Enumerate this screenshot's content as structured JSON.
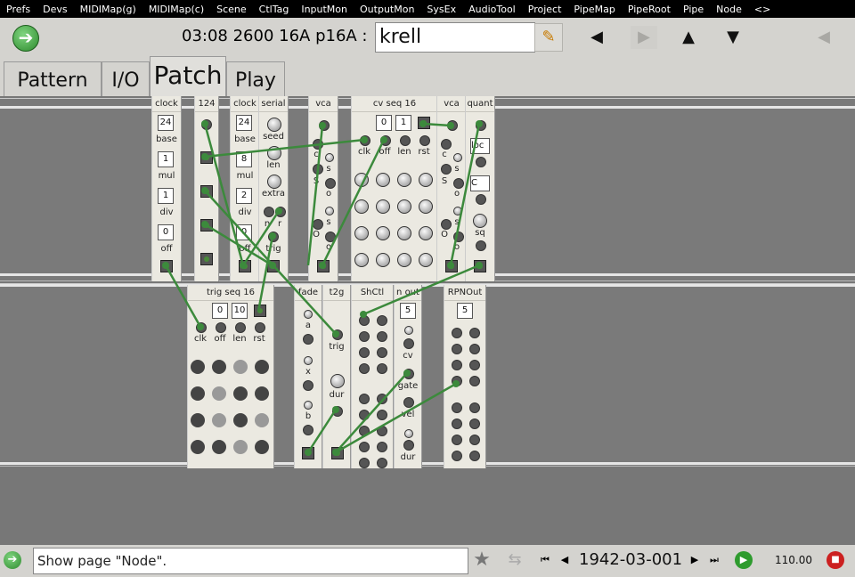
{
  "menu": [
    "Prefs",
    "Devs",
    "MIDIMap(g)",
    "MIDIMap(c)",
    "Scene",
    "CtlTag",
    "InputMon",
    "OutputMon",
    "SysEx",
    "AudioTool",
    "Project",
    "PipeMap",
    "PipeRoot",
    "Pipe",
    "Node",
    "<>"
  ],
  "toolbar": {
    "status": "03:08 2600  16A  p16A :",
    "name_value": "krell"
  },
  "tabs": [
    "Pattern",
    "I/O",
    "Patch",
    "Play"
  ],
  "modules_top": [
    {
      "title": "clock",
      "labels": [
        "base",
        "mul",
        "div",
        "off"
      ],
      "values": [
        "24",
        "1",
        "1",
        "0"
      ]
    },
    {
      "title": "124"
    },
    {
      "title": "clock",
      "labels": [
        "base",
        "mul",
        "div",
        "off"
      ],
      "values": [
        "24",
        "8",
        "2",
        "0"
      ]
    },
    {
      "title": "serial",
      "labels": [
        "seed",
        "len",
        "extra",
        "n",
        "r",
        "trig"
      ]
    },
    {
      "title": "vca",
      "labels": [
        "c",
        "S",
        "O",
        "s",
        "o",
        "s",
        "o"
      ]
    },
    {
      "title": "cv seq 16",
      "labels": [
        "clk",
        "off",
        "len",
        "rst"
      ],
      "values": [
        "0",
        "1"
      ]
    },
    {
      "title": "vca",
      "labels": [
        "c",
        "S",
        "O",
        "s",
        "o",
        "s",
        "o"
      ]
    },
    {
      "title": "quant",
      "labels": [
        "loc",
        "C",
        "sq"
      ]
    }
  ],
  "modules_bottom": [
    {
      "title": "trig seq 16",
      "labels": [
        "clk",
        "off",
        "len",
        "rst"
      ],
      "values": [
        "0",
        "10"
      ]
    },
    {
      "title": "fade",
      "labels": [
        "a",
        "x",
        "b"
      ]
    },
    {
      "title": "t2g",
      "labels": [
        "trig",
        "dur"
      ]
    },
    {
      "title": "ShCtl"
    },
    {
      "title": "n out",
      "labels": [
        "cv",
        "gate",
        "vel",
        "dur"
      ],
      "values": [
        "5"
      ]
    },
    {
      "title": "RPNOut",
      "values": [
        "5"
      ]
    }
  ],
  "status": {
    "message": "Show page \"Node\".",
    "date": "1942-03-001",
    "tempo": "110.00"
  },
  "colors": {
    "wire": "#3c8a3c",
    "accent": "#2e8b2e",
    "stop": "#cc2020"
  }
}
